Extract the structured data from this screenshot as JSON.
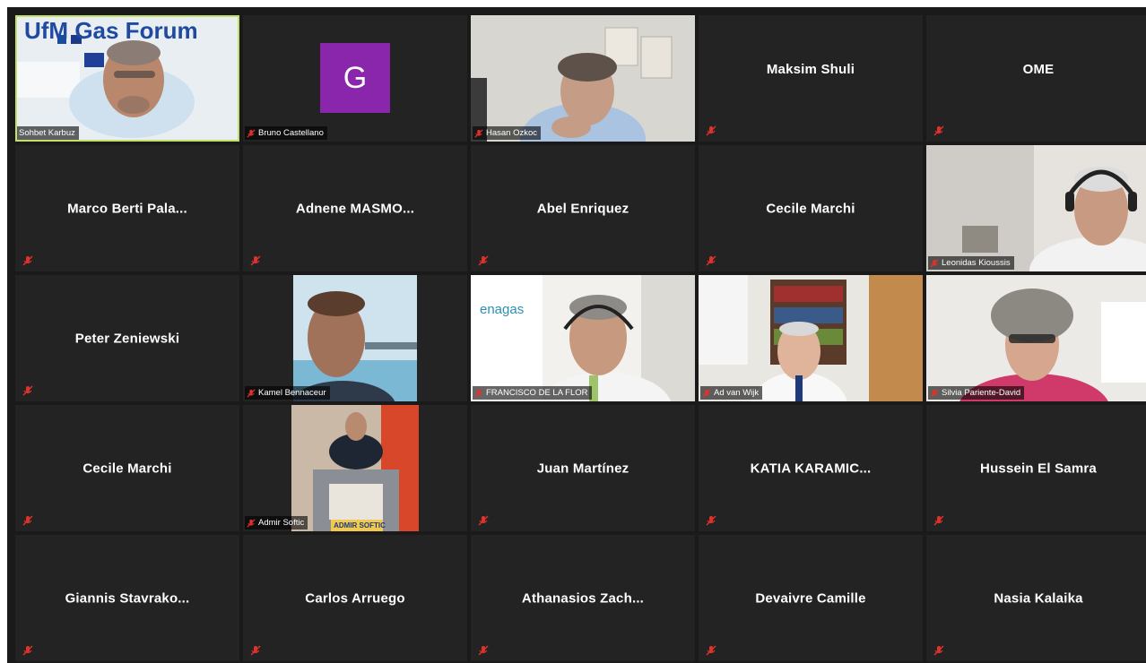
{
  "participants": [
    {
      "name": "Sohbet Karbuz"
    },
    {
      "name": "Bruno Castellano",
      "initial": "G"
    },
    {
      "name": "Hasan Ozkoc"
    },
    {
      "name": "Maksim Shuli"
    },
    {
      "name": "OME"
    },
    {
      "name": "Marco Berti Pala..."
    },
    {
      "name": "Adnene  MASMO..."
    },
    {
      "name": "Abel Enriquez"
    },
    {
      "name": "Cecile Marchi"
    },
    {
      "name": "Leonidas Kioussis"
    },
    {
      "name": "Peter Zeniewski"
    },
    {
      "name": "Kamel Bennaceur"
    },
    {
      "name": "FRANCISCO DE LA FLOR"
    },
    {
      "name": "Ad van Wijk"
    },
    {
      "name": "Silvia Pariente-David"
    },
    {
      "name": "Cecile Marchi"
    },
    {
      "name": "Admir Softic"
    },
    {
      "name": "Juan Martínez"
    },
    {
      "name": "KATIA  KARAMIC..."
    },
    {
      "name": "Hussein El Samra"
    },
    {
      "name": "Giannis  Stavrako..."
    },
    {
      "name": "Carlos Arruego"
    },
    {
      "name": "Athanasios  Zach..."
    },
    {
      "name": "Devaivre Camille"
    },
    {
      "name": "Nasia Kalaika"
    }
  ],
  "backdrops": {
    "sohbet_banner": "UfM Gas Forum",
    "enagas_logo": "enagas",
    "admir_podium": "ADMIR SOFTIC"
  },
  "colors": {
    "active_speaker_border": "#c3e06a",
    "tile_background": "#232323",
    "mic_muted": "#e0322b",
    "avatar": "#8a26ab"
  }
}
